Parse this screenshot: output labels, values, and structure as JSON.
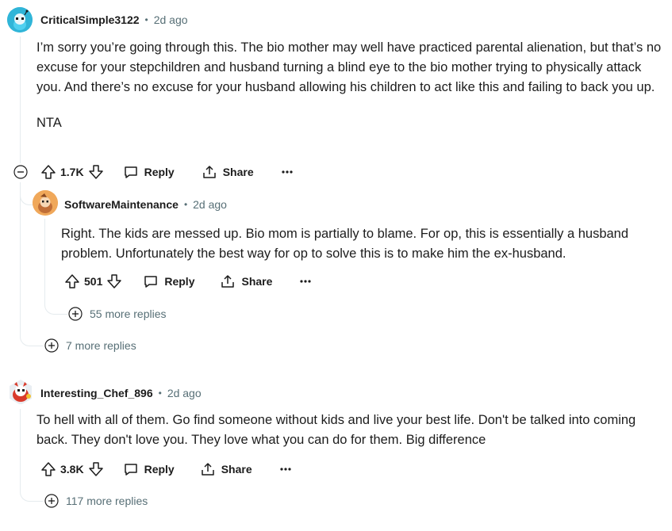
{
  "comments": [
    {
      "username": "CriticalSimple3122",
      "separator": "•",
      "time": "2d ago",
      "paragraphs": [
        "I’m sorry you’re going through this. The bio mother may well have practiced parental alienation, but that’s no excuse for your stepchildren and husband turning a blind eye to the bio mother trying to physically attack you. And there’s no excuse for your husband allowing his children to act like this and failing to back you up.",
        "NTA"
      ],
      "votes": "1.7K",
      "reply_label": "Reply",
      "share_label": "Share",
      "more_replies": "7 more replies",
      "avatar_color": "#30b5d8"
    },
    {
      "username": "SoftwareMaintenance",
      "separator": "•",
      "time": "2d ago",
      "paragraphs": [
        "Right. The kids are messed up. Bio mom is partially to blame. For op, this is essentially a husband problem. Unfortunately the best way for op to solve this is to make him the ex-husband."
      ],
      "votes": "501",
      "reply_label": "Reply",
      "share_label": "Share",
      "more_replies": "55 more replies",
      "avatar_color": "#f0a85a"
    },
    {
      "username": "Interesting_Chef_896",
      "separator": "•",
      "time": "2d ago",
      "paragraphs": [
        "To hell with all of them. Go find someone without kids and live your best life. Don't be talked into coming back. They don't love you. They love what you can do for them. Big difference"
      ],
      "votes": "3.8K",
      "reply_label": "Reply",
      "share_label": "Share",
      "more_replies": "117 more replies",
      "avatar_color": "#d93a2b"
    }
  ]
}
